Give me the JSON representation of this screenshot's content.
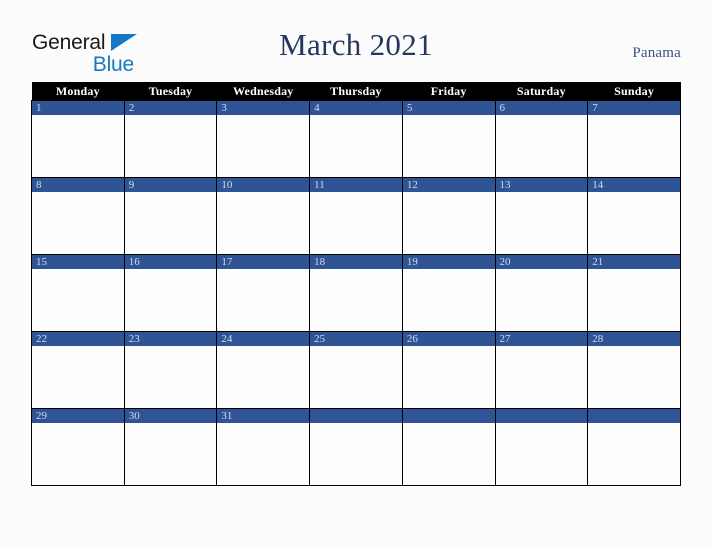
{
  "brand": {
    "name_part1": "General",
    "name_part2": "Blue",
    "triangle_color": "#1479c4",
    "text_color_part1": "#18181a",
    "text_color_part2": "#1479c4"
  },
  "header": {
    "title": "March 2021",
    "country": "Panama",
    "title_color": "#26375f"
  },
  "calendar": {
    "month": "March",
    "year": "2021",
    "accent_color": "#2f5496",
    "header_bg": "#000000",
    "day_names": [
      "Monday",
      "Tuesday",
      "Wednesday",
      "Thursday",
      "Friday",
      "Saturday",
      "Sunday"
    ],
    "weeks": [
      [
        {
          "day": "1"
        },
        {
          "day": "2"
        },
        {
          "day": "3"
        },
        {
          "day": "4"
        },
        {
          "day": "5"
        },
        {
          "day": "6"
        },
        {
          "day": "7"
        }
      ],
      [
        {
          "day": "8"
        },
        {
          "day": "9"
        },
        {
          "day": "10"
        },
        {
          "day": "11"
        },
        {
          "day": "12"
        },
        {
          "day": "13"
        },
        {
          "day": "14"
        }
      ],
      [
        {
          "day": "15"
        },
        {
          "day": "16"
        },
        {
          "day": "17"
        },
        {
          "day": "18"
        },
        {
          "day": "19"
        },
        {
          "day": "20"
        },
        {
          "day": "21"
        }
      ],
      [
        {
          "day": "22"
        },
        {
          "day": "23"
        },
        {
          "day": "24"
        },
        {
          "day": "25"
        },
        {
          "day": "26"
        },
        {
          "day": "27"
        },
        {
          "day": "28"
        }
      ],
      [
        {
          "day": "29"
        },
        {
          "day": "30"
        },
        {
          "day": "31"
        },
        {
          "day": ""
        },
        {
          "day": ""
        },
        {
          "day": ""
        },
        {
          "day": ""
        }
      ]
    ]
  }
}
